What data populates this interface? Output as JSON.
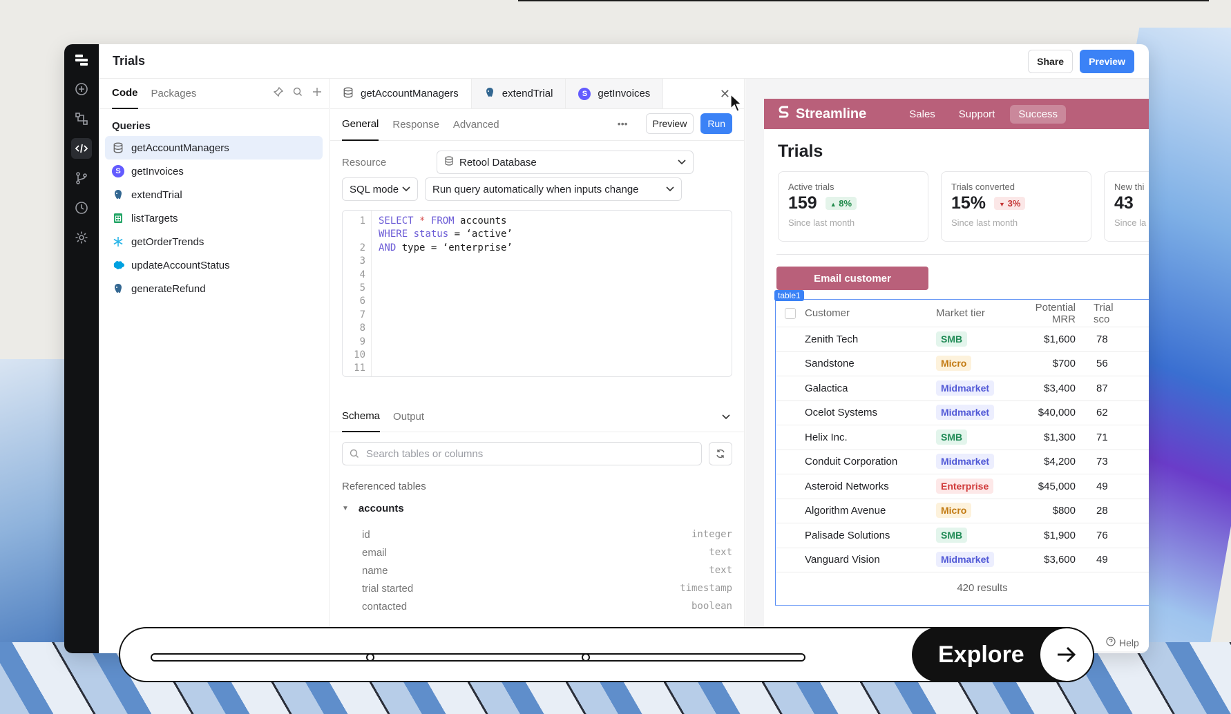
{
  "app": {
    "title": "Trials"
  },
  "header": {
    "share_label": "Share",
    "preview_label": "Preview"
  },
  "rail": [
    {
      "icon": "add-icon"
    },
    {
      "icon": "workflow-icon"
    },
    {
      "icon": "code-icon"
    },
    {
      "icon": "branch-icon"
    },
    {
      "icon": "history-icon"
    },
    {
      "icon": "settings-icon"
    }
  ],
  "left_panel": {
    "tabs": [
      "Code",
      "Packages"
    ],
    "section_title": "Queries",
    "queries": [
      {
        "label": "getAccountManagers",
        "icon": "database-icon",
        "color": "#6b7280"
      },
      {
        "label": "getInvoices",
        "icon": "stripe-icon",
        "color": "#635bff"
      },
      {
        "label": "extendTrial",
        "icon": "postgres-icon",
        "color": "#336791"
      },
      {
        "label": "listTargets",
        "icon": "sheets-icon",
        "color": "#23a566"
      },
      {
        "label": "getOrderTrends",
        "icon": "snowflake-icon",
        "color": "#29b5e8"
      },
      {
        "label": "updateAccountStatus",
        "icon": "salesforce-icon",
        "color": "#00a1e0"
      },
      {
        "label": "generateRefund",
        "icon": "postgres-icon",
        "color": "#336791"
      }
    ]
  },
  "editor": {
    "query_tabs": [
      {
        "label": "getAccountManagers",
        "icon": "database-icon"
      },
      {
        "label": "extendTrial",
        "icon": "postgres-icon"
      },
      {
        "label": "getInvoices",
        "icon": "stripe-icon"
      }
    ],
    "subtabs": [
      "General",
      "Response",
      "Advanced"
    ],
    "preview_label": "Preview",
    "run_label": "Run",
    "resource_label": "Resource",
    "resource_value": "Retool Database",
    "mode_value": "SQL mode",
    "trigger_value": "Run query automatically when inputs change",
    "line_numbers": [
      "1",
      "",
      "2",
      "3",
      "4",
      "5",
      "6",
      "7",
      "8",
      "9",
      "10",
      "11"
    ],
    "code": {
      "line1_kw1": "SELECT",
      "line1_op": "*",
      "line1_kw2": "FROM",
      "line1_rest": "accounts",
      "line2_kw": "WHERE",
      "line2_kw2": "status",
      "line2_op": "=",
      "line2_rest": "‘active’",
      "line3_kw": "AND",
      "line3_mid": "type",
      "line3_op": "=",
      "line3_rest": "‘enterprise’"
    },
    "schema_tabs": [
      "Schema",
      "Output"
    ],
    "search_placeholder": "Search tables or columns",
    "referenced_title": "Referenced tables",
    "table_name": "accounts",
    "columns": [
      {
        "name": "id",
        "type": "integer"
      },
      {
        "name": "email",
        "type": "text"
      },
      {
        "name": "name",
        "type": "text"
      },
      {
        "name": "trial started",
        "type": "timestamp"
      },
      {
        "name": "contacted",
        "type": "boolean"
      }
    ]
  },
  "preview": {
    "brand": "Streamline",
    "nav": [
      "Sales",
      "Support",
      "Success"
    ],
    "page_title": "Trials",
    "kpis": [
      {
        "label": "Active trials",
        "value": "159",
        "delta": "8%",
        "dir": "up",
        "sub": "Since last month"
      },
      {
        "label": "Trials converted",
        "value": "15%",
        "delta": "3%",
        "dir": "down",
        "sub": "Since last month"
      },
      {
        "label": "New thi",
        "value": "43",
        "delta": "",
        "dir": "",
        "sub": "Since la"
      }
    ],
    "email_button": "Email customer",
    "table_tag": "table1",
    "columns": [
      "Customer",
      "Market tier",
      "Potential MRR",
      "Trial sco"
    ],
    "rows": [
      {
        "customer": "Zenith Tech",
        "tier": "SMB",
        "mrr": "$1,600",
        "score": "78"
      },
      {
        "customer": "Sandstone",
        "tier": "Micro",
        "mrr": "$700",
        "score": "56"
      },
      {
        "customer": "Galactica",
        "tier": "Midmarket",
        "mrr": "$3,400",
        "score": "87"
      },
      {
        "customer": "Ocelot Systems",
        "tier": "Midmarket",
        "mrr": "$40,000",
        "score": "62"
      },
      {
        "customer": "Helix Inc.",
        "tier": "SMB",
        "mrr": "$1,300",
        "score": "71"
      },
      {
        "customer": "Conduit Corporation",
        "tier": "Midmarket",
        "mrr": "$4,200",
        "score": "73"
      },
      {
        "customer": "Asteroid Networks",
        "tier": "Enterprise",
        "mrr": "$45,000",
        "score": "49"
      },
      {
        "customer": "Algorithm Avenue",
        "tier": "Micro",
        "mrr": "$800",
        "score": "28"
      },
      {
        "customer": "Palisade Solutions",
        "tier": "SMB",
        "mrr": "$1,900",
        "score": "76"
      },
      {
        "customer": "Vanguard Vision",
        "tier": "Midmarket",
        "mrr": "$3,600",
        "score": "49"
      }
    ],
    "results": "420 results",
    "tier_colors": {
      "SMB": {
        "bg": "#e3f5ec",
        "fg": "#1f8a55"
      },
      "Micro": {
        "bg": "#fdf2dc",
        "fg": "#c27a12"
      },
      "Midmarket": {
        "bg": "#eceefe",
        "fg": "#5058d6"
      },
      "Enterprise": {
        "bg": "#fde8e8",
        "fg": "#d03b3b"
      }
    }
  },
  "overlay": {
    "explore_label": "Explore",
    "help_label": "Help"
  }
}
